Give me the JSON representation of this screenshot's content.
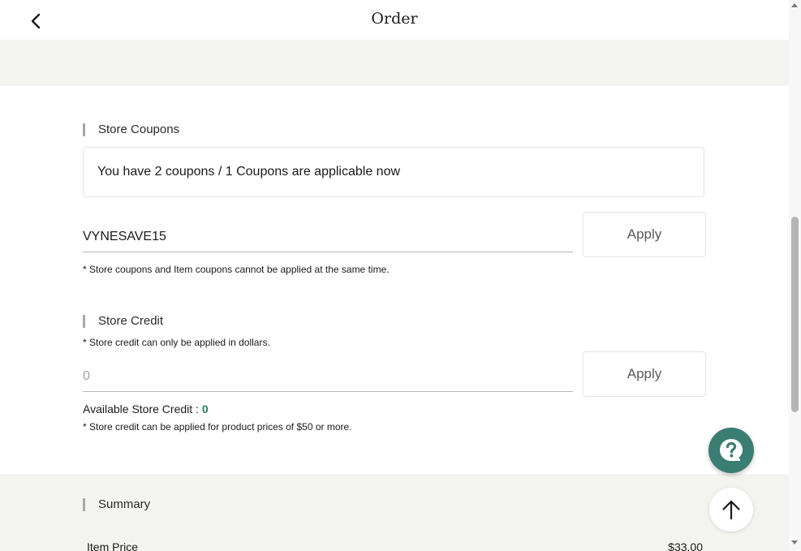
{
  "header": {
    "title": "Order",
    "back_icon": "chevron-left-icon"
  },
  "coupons": {
    "section_title": "Store Coupons",
    "availability_text": "You have 2 coupons / 1 Coupons are applicable now",
    "code_value": "VYNESAVE15",
    "apply_label": "Apply",
    "note": "* Store coupons and Item coupons cannot be applied at the same time."
  },
  "credit": {
    "section_title": "Store Credit",
    "note_dollars": "* Store credit can only be applied in dollars.",
    "input_placeholder": "0",
    "apply_label": "Apply",
    "available_label": "Available Store Credit : ",
    "available_value": "0",
    "note_min": "* Store credit can be applied for product prices of $50 or more."
  },
  "summary": {
    "section_title": "Summary",
    "item_price_label": "Item Price",
    "item_price_value": "$33.00"
  },
  "fabs": {
    "help_icon": "help-chat-icon",
    "top_icon": "arrow-up-icon"
  },
  "colors": {
    "accent": "#3a7d72",
    "credit_value": "#2f7a6a",
    "band_background": "#f3f3ef"
  }
}
